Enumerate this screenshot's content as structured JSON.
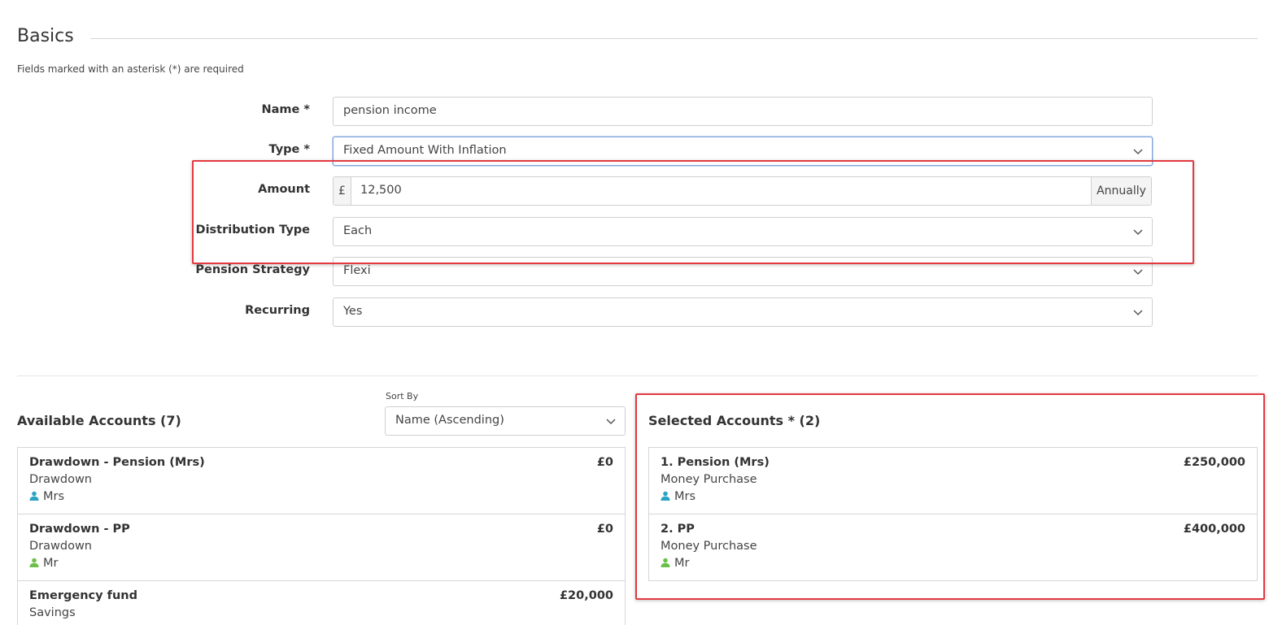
{
  "section": {
    "title": "Basics"
  },
  "required_note": "Fields marked with an asterisk (*) are required",
  "form": {
    "name": {
      "label": "Name *",
      "value": "pension income"
    },
    "type": {
      "label": "Type *",
      "value": "Fixed Amount With Inflation"
    },
    "amount": {
      "label": "Amount",
      "currency": "£",
      "value": "12,500",
      "frequency": "Annually"
    },
    "distribution_type": {
      "label": "Distribution Type",
      "value": "Each"
    },
    "pension_strategy": {
      "label": "Pension Strategy",
      "value": "Flexi"
    },
    "recurring": {
      "label": "Recurring",
      "value": "Yes"
    }
  },
  "available": {
    "title": "Available Accounts (7)",
    "sort_label": "Sort By",
    "sort_value": "Name (Ascending)",
    "items": [
      {
        "name": "Drawdown - Pension (Mrs)",
        "type": "Drawdown",
        "owner": "Mrs",
        "owner_color": "#2aa3c4",
        "value": "£0"
      },
      {
        "name": "Drawdown - PP",
        "type": "Drawdown",
        "owner": "Mr",
        "owner_color": "#6cc04a",
        "value": "£0"
      },
      {
        "name": "Emergency fund",
        "type": "Savings",
        "owner": "",
        "owner_color": "#6cc04a",
        "value": "£20,000"
      }
    ]
  },
  "selected": {
    "title": "Selected Accounts * (2)",
    "items": [
      {
        "name": "1. Pension (Mrs)",
        "type": "Money Purchase",
        "owner": "Mrs",
        "owner_color": "#2aa3c4",
        "value": "£250,000"
      },
      {
        "name": "2. PP",
        "type": "Money Purchase",
        "owner": "Mr",
        "owner_color": "#6cc04a",
        "value": "£400,000"
      }
    ]
  },
  "colors": {
    "highlight": "#e3393f",
    "focus_border": "#82a5db",
    "mrs_icon": "#2aa3c4",
    "mr_icon": "#6cc04a"
  }
}
